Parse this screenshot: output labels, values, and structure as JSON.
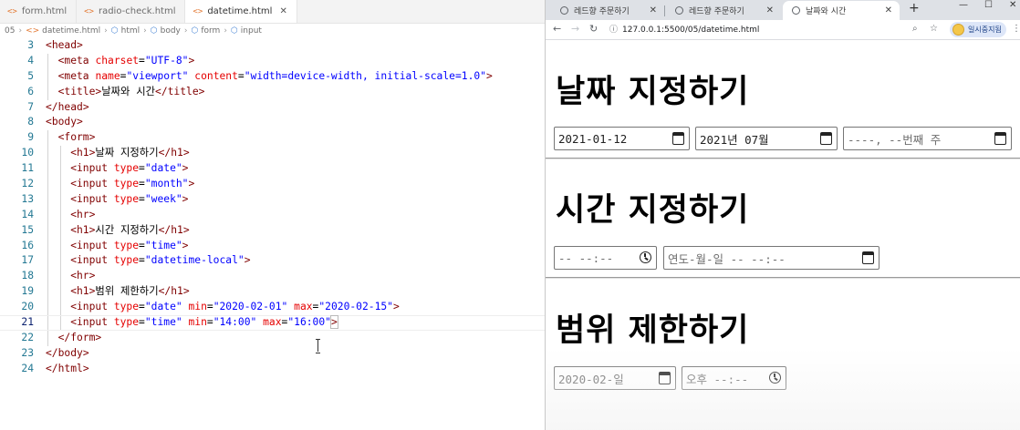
{
  "editor": {
    "tabs": [
      {
        "label": "form.html",
        "active": false
      },
      {
        "label": "radio-check.html",
        "active": false
      },
      {
        "label": "datetime.html",
        "active": true
      }
    ],
    "breadcrumb": [
      "05",
      "datetime.html",
      "html",
      "body",
      "form",
      "input"
    ],
    "lines": [
      {
        "n": "3",
        "indent": 0,
        "parts": [
          [
            "br",
            "<"
          ],
          [
            "tag",
            "head"
          ],
          [
            "br",
            ">"
          ]
        ]
      },
      {
        "n": "4",
        "indent": 1,
        "parts": [
          [
            "br",
            "<"
          ],
          [
            "tag",
            "meta"
          ],
          [
            "txt",
            " "
          ],
          [
            "attr",
            "charset"
          ],
          [
            "txt",
            "="
          ],
          [
            "val",
            "\"UTF-8\""
          ],
          [
            "br",
            ">"
          ]
        ]
      },
      {
        "n": "5",
        "indent": 1,
        "parts": [
          [
            "br",
            "<"
          ],
          [
            "tag",
            "meta"
          ],
          [
            "txt",
            " "
          ],
          [
            "attr",
            "name"
          ],
          [
            "txt",
            "="
          ],
          [
            "val",
            "\"viewport\""
          ],
          [
            "txt",
            " "
          ],
          [
            "attr",
            "content"
          ],
          [
            "txt",
            "="
          ],
          [
            "val",
            "\"width=device-width, initial-scale=1.0\""
          ],
          [
            "br",
            ">"
          ]
        ]
      },
      {
        "n": "6",
        "indent": 1,
        "parts": [
          [
            "br",
            "<"
          ],
          [
            "tag",
            "title"
          ],
          [
            "br",
            ">"
          ],
          [
            "txt",
            "날짜와 시간"
          ],
          [
            "br",
            "</"
          ],
          [
            "tag",
            "title"
          ],
          [
            "br",
            ">"
          ]
        ]
      },
      {
        "n": "7",
        "indent": 0,
        "parts": [
          [
            "br",
            "</"
          ],
          [
            "tag",
            "head"
          ],
          [
            "br",
            ">"
          ]
        ]
      },
      {
        "n": "8",
        "indent": 0,
        "parts": [
          [
            "br",
            "<"
          ],
          [
            "tag",
            "body"
          ],
          [
            "br",
            ">"
          ]
        ]
      },
      {
        "n": "9",
        "indent": 1,
        "parts": [
          [
            "br",
            "<"
          ],
          [
            "tag",
            "form"
          ],
          [
            "br",
            ">"
          ]
        ]
      },
      {
        "n": "10",
        "indent": 2,
        "parts": [
          [
            "br",
            "<"
          ],
          [
            "tag",
            "h1"
          ],
          [
            "br",
            ">"
          ],
          [
            "txt",
            "날짜 지정하기"
          ],
          [
            "br",
            "</"
          ],
          [
            "tag",
            "h1"
          ],
          [
            "br",
            ">"
          ]
        ]
      },
      {
        "n": "11",
        "indent": 2,
        "parts": [
          [
            "br",
            "<"
          ],
          [
            "tag",
            "input"
          ],
          [
            "txt",
            " "
          ],
          [
            "attr",
            "type"
          ],
          [
            "txt",
            "="
          ],
          [
            "val",
            "\"date\""
          ],
          [
            "br",
            ">"
          ]
        ]
      },
      {
        "n": "12",
        "indent": 2,
        "parts": [
          [
            "br",
            "<"
          ],
          [
            "tag",
            "input"
          ],
          [
            "txt",
            " "
          ],
          [
            "attr",
            "type"
          ],
          [
            "txt",
            "="
          ],
          [
            "val",
            "\"month\""
          ],
          [
            "br",
            ">"
          ]
        ]
      },
      {
        "n": "13",
        "indent": 2,
        "parts": [
          [
            "br",
            "<"
          ],
          [
            "tag",
            "input"
          ],
          [
            "txt",
            " "
          ],
          [
            "attr",
            "type"
          ],
          [
            "txt",
            "="
          ],
          [
            "val",
            "\"week\""
          ],
          [
            "br",
            ">"
          ]
        ]
      },
      {
        "n": "14",
        "indent": 2,
        "parts": [
          [
            "br",
            "<"
          ],
          [
            "tag",
            "hr"
          ],
          [
            "br",
            ">"
          ]
        ]
      },
      {
        "n": "15",
        "indent": 2,
        "parts": [
          [
            "br",
            "<"
          ],
          [
            "tag",
            "h1"
          ],
          [
            "br",
            ">"
          ],
          [
            "txt",
            "시간 지정하기"
          ],
          [
            "br",
            "</"
          ],
          [
            "tag",
            "h1"
          ],
          [
            "br",
            ">"
          ]
        ]
      },
      {
        "n": "16",
        "indent": 2,
        "parts": [
          [
            "br",
            "<"
          ],
          [
            "tag",
            "input"
          ],
          [
            "txt",
            " "
          ],
          [
            "attr",
            "type"
          ],
          [
            "txt",
            "="
          ],
          [
            "val",
            "\"time\""
          ],
          [
            "br",
            ">"
          ]
        ]
      },
      {
        "n": "17",
        "indent": 2,
        "parts": [
          [
            "br",
            "<"
          ],
          [
            "tag",
            "input"
          ],
          [
            "txt",
            " "
          ],
          [
            "attr",
            "type"
          ],
          [
            "txt",
            "="
          ],
          [
            "val",
            "\"datetime-local\""
          ],
          [
            "br",
            ">"
          ]
        ]
      },
      {
        "n": "18",
        "indent": 2,
        "parts": [
          [
            "br",
            "<"
          ],
          [
            "tag",
            "hr"
          ],
          [
            "br",
            ">"
          ]
        ]
      },
      {
        "n": "19",
        "indent": 2,
        "parts": [
          [
            "br",
            "<"
          ],
          [
            "tag",
            "h1"
          ],
          [
            "br",
            ">"
          ],
          [
            "txt",
            "범위 제한하기"
          ],
          [
            "br",
            "</"
          ],
          [
            "tag",
            "h1"
          ],
          [
            "br",
            ">"
          ]
        ]
      },
      {
        "n": "20",
        "indent": 2,
        "parts": [
          [
            "br",
            "<"
          ],
          [
            "tag",
            "input"
          ],
          [
            "txt",
            " "
          ],
          [
            "attr",
            "type"
          ],
          [
            "txt",
            "="
          ],
          [
            "val",
            "\"date\""
          ],
          [
            "txt",
            " "
          ],
          [
            "attr",
            "min"
          ],
          [
            "txt",
            "="
          ],
          [
            "val",
            "\"2020-02-01\""
          ],
          [
            "txt",
            " "
          ],
          [
            "attr",
            "max"
          ],
          [
            "txt",
            "="
          ],
          [
            "val",
            "\"2020-02-15\""
          ],
          [
            "br",
            ">"
          ]
        ]
      },
      {
        "n": "21",
        "indent": 2,
        "current": true,
        "parts": [
          [
            "br",
            "<"
          ],
          [
            "tag",
            "input"
          ],
          [
            "txt",
            " "
          ],
          [
            "attr",
            "type"
          ],
          [
            "txt",
            "="
          ],
          [
            "val",
            "\"time\""
          ],
          [
            "txt",
            " "
          ],
          [
            "attr",
            "min"
          ],
          [
            "txt",
            "="
          ],
          [
            "val",
            "\"14:00\""
          ],
          [
            "txt",
            " "
          ],
          [
            "attr",
            "max"
          ],
          [
            "txt",
            "="
          ],
          [
            "val",
            "\"16:00\""
          ],
          [
            "br",
            ">"
          ]
        ]
      },
      {
        "n": "22",
        "indent": 1,
        "parts": [
          [
            "br",
            "</"
          ],
          [
            "tag",
            "form"
          ],
          [
            "br",
            ">"
          ]
        ]
      },
      {
        "n": "23",
        "indent": 0,
        "parts": [
          [
            "br",
            "</"
          ],
          [
            "tag",
            "body"
          ],
          [
            "br",
            ">"
          ]
        ]
      },
      {
        "n": "24",
        "indent": 0,
        "parts": [
          [
            "br",
            "</"
          ],
          [
            "tag",
            "html"
          ],
          [
            "br",
            ">"
          ]
        ]
      }
    ]
  },
  "browser": {
    "tabs": [
      {
        "label": "레드향 주문하기",
        "active": false
      },
      {
        "label": "레드향 주문하기",
        "active": false
      },
      {
        "label": "날짜와 시간",
        "active": true
      }
    ],
    "new_tab": "+",
    "url": "127.0.0.1:5500/05/datetime.html",
    "profile_label": "일시중지됨",
    "page": {
      "h1_date": "날짜 지정하기",
      "date_value": "2021-01-12",
      "month_value": "2021년 07월",
      "week_value": "----, --번째 주",
      "h1_time": "시간 지정하기",
      "time_value": "-- --:--",
      "datetime_value": "연도-월-일 -- --:--",
      "h1_range": "범위 제한하기",
      "range_date_value": "2020-02-일",
      "range_time_value": "오후 --:--"
    }
  }
}
